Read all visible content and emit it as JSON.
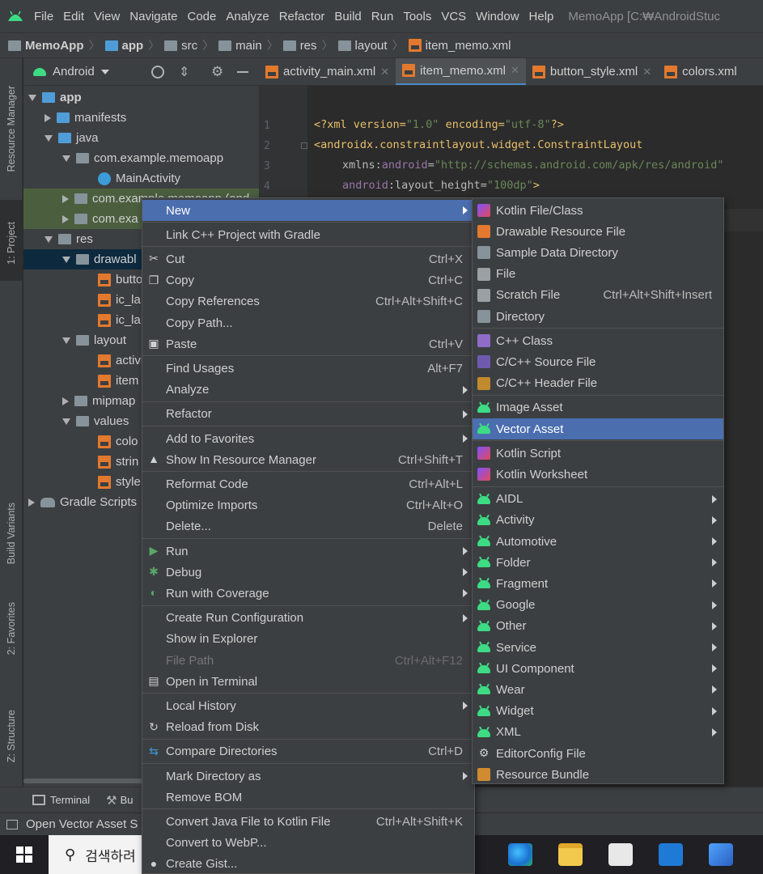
{
  "menubar": {
    "items": [
      "File",
      "Edit",
      "View",
      "Navigate",
      "Code",
      "Analyze",
      "Refactor",
      "Build",
      "Run",
      "Tools",
      "VCS",
      "Window",
      "Help"
    ],
    "title": "MemoApp [C:₩AndroidStuc"
  },
  "breadcrumb": [
    "MemoApp",
    "app",
    "src",
    "main",
    "res",
    "layout",
    "item_memo.xml"
  ],
  "left_tabs": [
    "Resource Manager",
    "1: Project",
    "Build Variants",
    "2: Favorites",
    "Z: Structure"
  ],
  "project_panel": {
    "view_selector": "Android",
    "tree": [
      {
        "label": "app",
        "bold": true
      },
      {
        "label": "manifests"
      },
      {
        "label": "java"
      },
      {
        "label": "com.example.memoapp"
      },
      {
        "label": "MainActivity"
      },
      {
        "label": "com.example.memoapp (and"
      },
      {
        "label": "com.exa"
      },
      {
        "label": "res"
      },
      {
        "label": "drawabl"
      },
      {
        "label": "butto"
      },
      {
        "label": "ic_la"
      },
      {
        "label": "ic_la"
      },
      {
        "label": "layout"
      },
      {
        "label": "activi"
      },
      {
        "label": "item"
      },
      {
        "label": "mipmap"
      },
      {
        "label": "values"
      },
      {
        "label": "colo"
      },
      {
        "label": "strin"
      },
      {
        "label": "style"
      },
      {
        "label": "Gradle Scripts"
      }
    ]
  },
  "editor": {
    "tabs": [
      {
        "label": "activity_main.xml"
      },
      {
        "label": "item_memo.xml",
        "active": true
      },
      {
        "label": "button_style.xml"
      },
      {
        "label": "colors.xml"
      }
    ],
    "line_numbers": [
      "1",
      "2",
      "3",
      "4"
    ],
    "code": {
      "l1_a": "<?xml version=",
      "l1_v1": "\"1.0\"",
      "l1_b": " encoding=",
      "l1_v2": "\"utf-8\"",
      "l1_c": "?>",
      "l2": "<androidx.constraintlayout.widget.ConstraintLayout",
      "l3_ns": "xmlns:",
      "l3_attr": "android",
      "l3_eq": "=",
      "l3_val": "\"http://schemas.android.com/apk/res/android\"",
      "l4_ns": "android",
      "l4_attr": ":layout_height=",
      "l4_val": "\"100dp\"",
      "l4_end": ">"
    }
  },
  "context_menu": {
    "items": [
      {
        "label": "New",
        "submenu": true,
        "active": true
      },
      {
        "sep": true
      },
      {
        "label": "Link C++ Project with Gradle"
      },
      {
        "sep": true
      },
      {
        "label": "Cut",
        "shortcut": "Ctrl+X",
        "icon": "scissors-icon"
      },
      {
        "label": "Copy",
        "shortcut": "Ctrl+C",
        "icon": "copy-icon"
      },
      {
        "label": "Copy References",
        "shortcut": "Ctrl+Alt+Shift+C"
      },
      {
        "label": "Copy Path..."
      },
      {
        "label": "Paste",
        "shortcut": "Ctrl+V",
        "icon": "paste-icon"
      },
      {
        "sep": true
      },
      {
        "label": "Find Usages",
        "shortcut": "Alt+F7"
      },
      {
        "label": "Analyze",
        "submenu": true
      },
      {
        "sep": true
      },
      {
        "label": "Refactor",
        "submenu": true
      },
      {
        "sep": true
      },
      {
        "label": "Add to Favorites",
        "submenu": true
      },
      {
        "label": "Show In Resource Manager",
        "shortcut": "Ctrl+Shift+T",
        "icon": "resource-manager-icon"
      },
      {
        "sep": true
      },
      {
        "label": "Reformat Code",
        "shortcut": "Ctrl+Alt+L"
      },
      {
        "label": "Optimize Imports",
        "shortcut": "Ctrl+Alt+O"
      },
      {
        "label": "Delete...",
        "shortcut": "Delete"
      },
      {
        "sep": true
      },
      {
        "label": "Run",
        "submenu": true,
        "icon": "run-icon"
      },
      {
        "label": "Debug",
        "submenu": true,
        "icon": "debug-icon"
      },
      {
        "label": "Run with Coverage",
        "submenu": true,
        "icon": "coverage-icon"
      },
      {
        "sep": true
      },
      {
        "label": "Create Run Configuration",
        "submenu": true
      },
      {
        "label": "Show in Explorer"
      },
      {
        "label": "File Path",
        "shortcut": "Ctrl+Alt+F12",
        "disabled": true
      },
      {
        "label": "Open in Terminal",
        "icon": "terminal-icon"
      },
      {
        "sep": true
      },
      {
        "label": "Local History",
        "submenu": true
      },
      {
        "label": "Reload from Disk",
        "icon": "reload-icon"
      },
      {
        "sep": true
      },
      {
        "label": "Compare Directories",
        "shortcut": "Ctrl+D",
        "icon": "compare-icon"
      },
      {
        "sep": true
      },
      {
        "label": "Mark Directory as",
        "submenu": true
      },
      {
        "label": "Remove BOM"
      },
      {
        "sep": true
      },
      {
        "label": "Convert Java File to Kotlin File",
        "shortcut": "Ctrl+Alt+Shift+K"
      },
      {
        "label": "Convert to WebP..."
      },
      {
        "label": "Create Gist...",
        "icon": "github-icon"
      }
    ]
  },
  "new_submenu": {
    "items": [
      {
        "label": "Kotlin File/Class",
        "icon": "kotlin-file-icon"
      },
      {
        "label": "Drawable Resource File",
        "icon": "xml-file-icon"
      },
      {
        "label": "Sample Data Directory",
        "icon": "folder-icon"
      },
      {
        "label": "File",
        "icon": "file-icon"
      },
      {
        "label": "Scratch File",
        "shortcut": "Ctrl+Alt+Shift+Insert",
        "icon": "scratch-file-icon"
      },
      {
        "label": "Directory",
        "icon": "folder-icon"
      },
      {
        "sep": true
      },
      {
        "label": "C++ Class",
        "icon": "cpp-class-icon"
      },
      {
        "label": "C/C++ Source File",
        "icon": "cpp-source-icon"
      },
      {
        "label": "C/C++ Header File",
        "icon": "cpp-header-icon"
      },
      {
        "sep": true
      },
      {
        "label": "Image Asset",
        "icon": "android-icon"
      },
      {
        "label": "Vector Asset",
        "icon": "android-icon",
        "active": true
      },
      {
        "sep": true
      },
      {
        "label": "Kotlin Script",
        "icon": "kotlin-file-icon"
      },
      {
        "label": "Kotlin Worksheet",
        "icon": "kotlin-file-icon"
      },
      {
        "sep": true
      },
      {
        "label": "AIDL",
        "submenu": true,
        "icon": "android-icon"
      },
      {
        "label": "Activity",
        "submenu": true,
        "icon": "android-icon"
      },
      {
        "label": "Automotive",
        "submenu": true,
        "icon": "android-icon"
      },
      {
        "label": "Folder",
        "submenu": true,
        "icon": "android-icon"
      },
      {
        "label": "Fragment",
        "submenu": true,
        "icon": "android-icon"
      },
      {
        "label": "Google",
        "submenu": true,
        "icon": "android-icon"
      },
      {
        "label": "Other",
        "submenu": true,
        "icon": "android-icon"
      },
      {
        "label": "Service",
        "submenu": true,
        "icon": "android-icon"
      },
      {
        "label": "UI Component",
        "submenu": true,
        "icon": "android-icon"
      },
      {
        "label": "Wear",
        "submenu": true,
        "icon": "android-icon"
      },
      {
        "label": "Widget",
        "submenu": true,
        "icon": "android-icon"
      },
      {
        "label": "XML",
        "submenu": true,
        "icon": "android-icon"
      },
      {
        "label": "EditorConfig File",
        "icon": "gear-icon"
      },
      {
        "label": "Resource Bundle",
        "icon": "resource-bundle-icon"
      }
    ]
  },
  "bottom_bar": {
    "terminal": "Terminal",
    "build": "Bu"
  },
  "status_bar": {
    "text": "Open Vector Asset S"
  },
  "taskbar": {
    "search_placeholder": "검색하려"
  },
  "colors": {
    "accent": "#4b6eaf",
    "android_green": "#3ddc84",
    "background": "#2b2b2b",
    "panel": "#3c3f41"
  }
}
